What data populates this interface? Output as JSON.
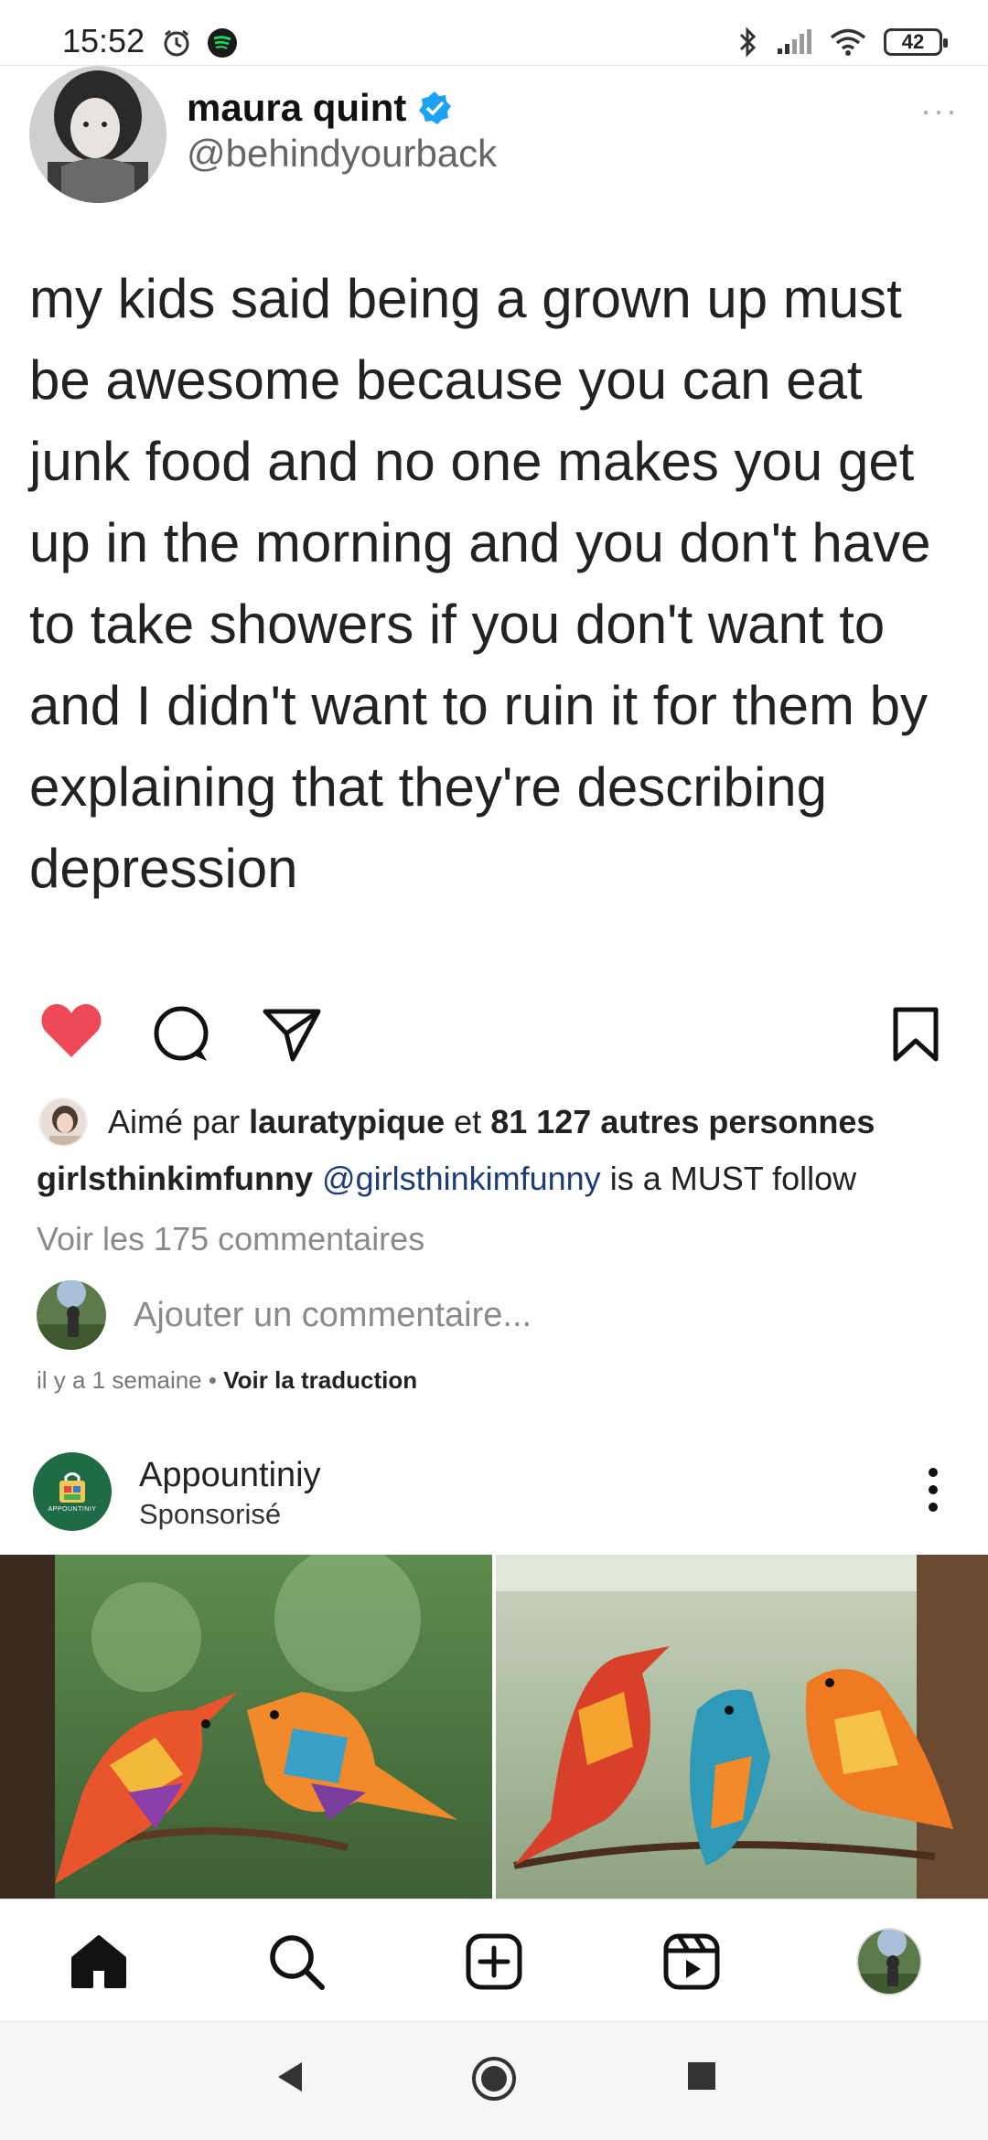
{
  "status_bar": {
    "time": "15:52",
    "battery": "42"
  },
  "tweet": {
    "author_name": "maura quint",
    "author_handle": "@behindyourback",
    "more": "···",
    "text": "my kids said being a grown up must be awesome because you can eat junk food and no one makes you get up in the morning and you don't have to take showers if you don't want to and I didn't want to ruin it for them by explaining that they're describing depression"
  },
  "post": {
    "liked_prefix": "Aimé par",
    "liked_user": "lauratypique",
    "liked_mid": "et",
    "liked_count": "81 127 autres personnes",
    "caption_user": "girlsthinkimfunny",
    "caption_mention": "@girlsthinkimfunny",
    "caption_text": "is a MUST follow",
    "view_comments": "Voir les 175 commentaires",
    "add_comment_placeholder": "Ajouter un commentaire...",
    "time_ago": "il y a 1 semaine",
    "separator": "•",
    "see_translation": "Voir la traduction",
    "heart_color": "#ed4956"
  },
  "sponsored": {
    "name": "Appountiniy",
    "label": "Sponsorisé",
    "logo_text": "APPOUNTINIY",
    "brand_color": "#1f6b45"
  },
  "nav": {
    "items": [
      "home-icon",
      "search-icon",
      "create-icon",
      "reels-icon",
      "profile-avatar"
    ]
  }
}
